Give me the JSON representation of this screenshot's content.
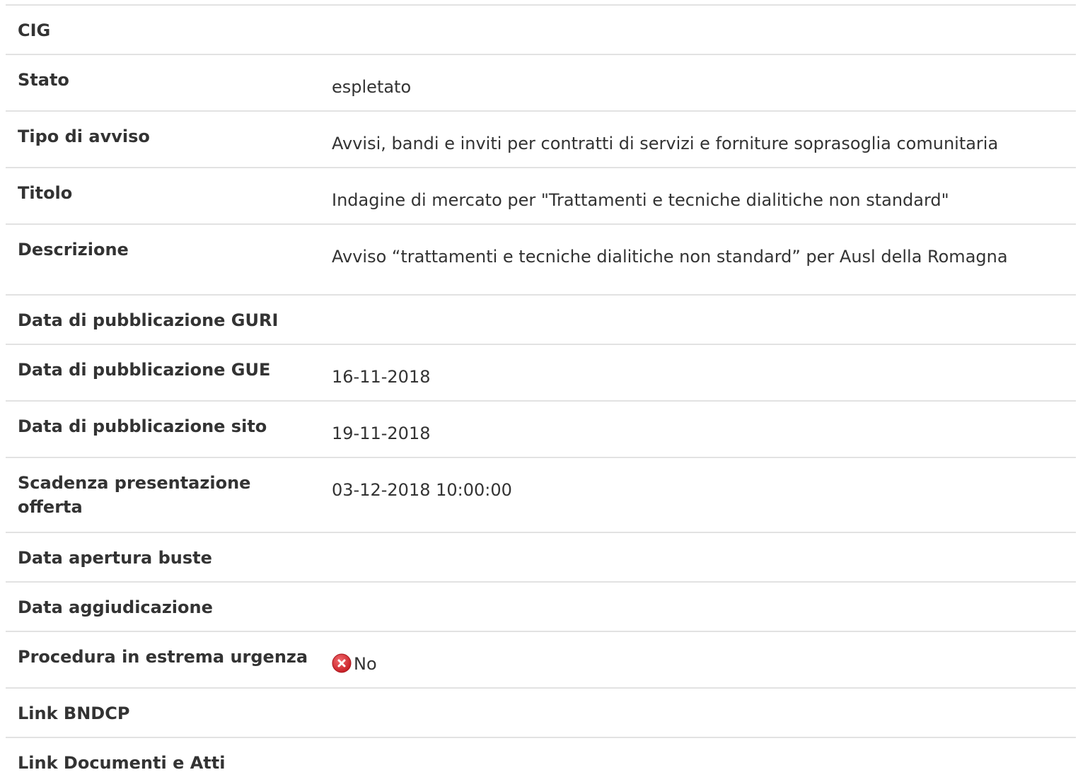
{
  "colors": {
    "text": "#333333",
    "divider": "#e2e2e2",
    "no_icon": "#d9343a"
  },
  "fields": {
    "cig": {
      "label": "CIG",
      "value": ""
    },
    "stato": {
      "label": "Stato",
      "value": "espletato"
    },
    "tipo_avviso": {
      "label": "Tipo di avviso",
      "value": "Avvisi, bandi e inviti per contratti di servizi e forniture soprasoglia comunitaria"
    },
    "titolo": {
      "label": "Titolo",
      "value": "Indagine di mercato per \"Trattamenti e tecniche dialitiche non standard\""
    },
    "descrizione": {
      "label": "Descrizione",
      "value": "Avviso “trattamenti e tecniche dialitiche non standard” per Ausl della Romagna"
    },
    "data_guri": {
      "label": "Data di pubblicazione GURI",
      "value": ""
    },
    "data_gue": {
      "label": "Data di pubblicazione GUE",
      "value": "16-11-2018"
    },
    "data_sito": {
      "label": "Data di pubblicazione sito",
      "value": "19-11-2018"
    },
    "scadenza": {
      "label": "Scadenza presentazione offerta",
      "value": "03-12-2018 10:00:00"
    },
    "apertura_buste": {
      "label": "Data apertura buste",
      "value": ""
    },
    "aggiudicazione": {
      "label": "Data aggiudicazione",
      "value": ""
    },
    "estrema_urgenza": {
      "label": "Procedura in estrema urgenza",
      "value": "No",
      "icon": "no-cross-icon"
    },
    "link_bndcp": {
      "label": "Link BNDCP",
      "value": ""
    },
    "link_documenti": {
      "label": "Link Documenti e Atti",
      "value": ""
    }
  }
}
